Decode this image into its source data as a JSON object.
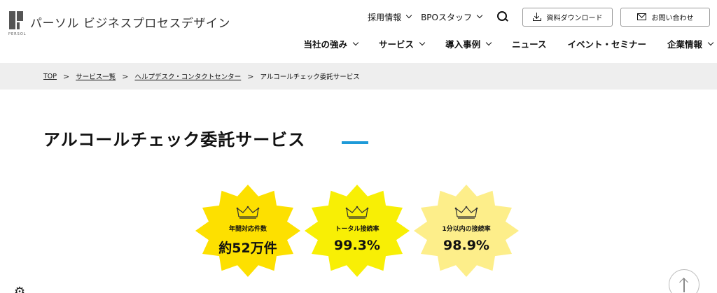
{
  "header": {
    "logo_text": "パーソル ビジネスプロセスデザイン",
    "logo_sub": "PERSOL",
    "util_links": [
      {
        "label": "採用情報"
      },
      {
        "label": "BPOスタッフ"
      }
    ],
    "download_label": "資料ダウンロード",
    "contact_label": "お問い合わせ"
  },
  "nav": {
    "items": [
      {
        "label": "当社の強み"
      },
      {
        "label": "サービス"
      },
      {
        "label": "導入事例"
      },
      {
        "label": "ニュース"
      },
      {
        "label": "イベント・セミナー"
      },
      {
        "label": "企業情報"
      }
    ]
  },
  "breadcrumb": {
    "items": [
      {
        "label": "TOP"
      },
      {
        "label": "サービス一覧"
      },
      {
        "label": "ヘルプデスク・コンタクトセンター"
      }
    ],
    "current": "アルコールチェック委託サービス"
  },
  "page": {
    "title": "アルコールチェック委託サービス",
    "accent_color": "#1e9ad8"
  },
  "stats": [
    {
      "label": "年間対応件数",
      "value": "約52万件",
      "color": "#fde000"
    },
    {
      "label": "トータル接続率",
      "value": "99.3%",
      "color": "#f8ef05"
    },
    {
      "label": "1分以内の接続率",
      "value": "98.9%",
      "color": "#fdee8a"
    }
  ]
}
